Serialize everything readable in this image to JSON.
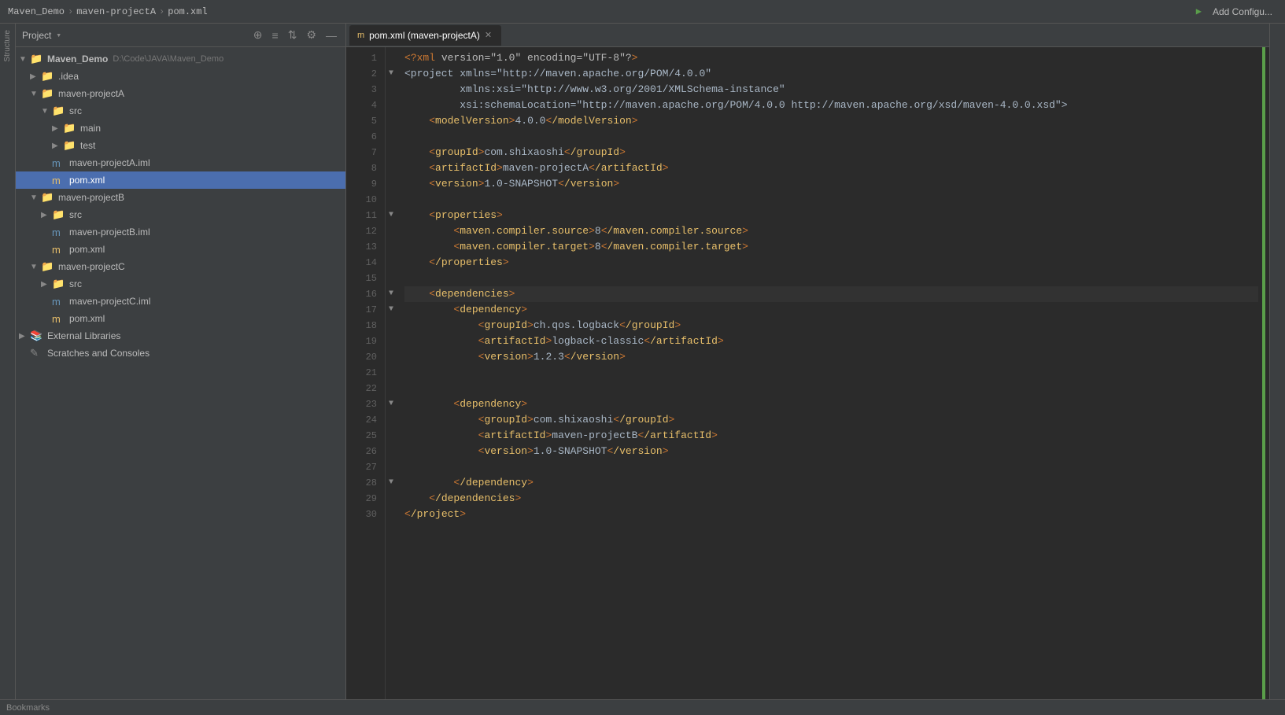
{
  "titleBar": {
    "breadcrumb": [
      "Maven_Demo",
      "maven-projectA",
      "pom.xml"
    ],
    "addConfigLabel": "Add Configu..."
  },
  "projectPanel": {
    "title": "Project",
    "dropdownArrow": "▾",
    "icons": [
      "⊕",
      "≡",
      "⇅",
      "⚙",
      "—"
    ]
  },
  "tree": {
    "items": [
      {
        "id": "project-root",
        "label": "Project ▾",
        "depth": 0,
        "arrow": "",
        "icon": "📁",
        "iconClass": ""
      },
      {
        "id": "maven-demo",
        "label": "Maven_Demo",
        "depth": 0,
        "arrow": "",
        "icon": "📁",
        "iconClass": "folder-icon",
        "extra": "D:\\Code\\JAVA\\Maven_Demo"
      },
      {
        "id": "idea",
        "label": ".idea",
        "depth": 1,
        "arrow": "▶",
        "icon": "📁",
        "iconClass": "folder-icon"
      },
      {
        "id": "maven-projectA",
        "label": "maven-projectA",
        "depth": 1,
        "arrow": "▼",
        "icon": "📁",
        "iconClass": "folder-icon"
      },
      {
        "id": "src-a",
        "label": "src",
        "depth": 2,
        "arrow": "▼",
        "icon": "📁",
        "iconClass": "folder-icon"
      },
      {
        "id": "main",
        "label": "main",
        "depth": 3,
        "arrow": "▶",
        "icon": "📁",
        "iconClass": "folder-icon"
      },
      {
        "id": "test",
        "label": "test",
        "depth": 3,
        "arrow": "▶",
        "icon": "📁",
        "iconClass": "folder-icon"
      },
      {
        "id": "iml-a",
        "label": "maven-projectA.iml",
        "depth": 2,
        "arrow": "",
        "icon": "m",
        "iconClass": "file-icon-iml"
      },
      {
        "id": "pom-a",
        "label": "pom.xml",
        "depth": 2,
        "arrow": "",
        "icon": "m",
        "iconClass": "file-icon-xml",
        "selected": true
      },
      {
        "id": "maven-projectB",
        "label": "maven-projectB",
        "depth": 1,
        "arrow": "▼",
        "icon": "📁",
        "iconClass": "folder-icon"
      },
      {
        "id": "src-b",
        "label": "src",
        "depth": 2,
        "arrow": "▶",
        "icon": "📁",
        "iconClass": "folder-icon"
      },
      {
        "id": "iml-b",
        "label": "maven-projectB.iml",
        "depth": 2,
        "arrow": "",
        "icon": "m",
        "iconClass": "file-icon-iml"
      },
      {
        "id": "pom-b",
        "label": "pom.xml",
        "depth": 2,
        "arrow": "",
        "icon": "m",
        "iconClass": "file-icon-xml"
      },
      {
        "id": "maven-projectC",
        "label": "maven-projectC",
        "depth": 1,
        "arrow": "▼",
        "icon": "📁",
        "iconClass": "folder-icon"
      },
      {
        "id": "src-c",
        "label": "src",
        "depth": 2,
        "arrow": "▶",
        "icon": "📁",
        "iconClass": "folder-icon"
      },
      {
        "id": "iml-c",
        "label": "maven-projectC.iml",
        "depth": 2,
        "arrow": "",
        "icon": "m",
        "iconClass": "file-icon-iml"
      },
      {
        "id": "pom-c",
        "label": "pom.xml",
        "depth": 2,
        "arrow": "",
        "icon": "m",
        "iconClass": "file-icon-xml"
      },
      {
        "id": "external-libs",
        "label": "External Libraries",
        "depth": 0,
        "arrow": "▶",
        "icon": "📚",
        "iconClass": "external-icon"
      },
      {
        "id": "scratches",
        "label": "Scratches and Consoles",
        "depth": 0,
        "arrow": "",
        "icon": "✎",
        "iconClass": "scratches-icon"
      }
    ]
  },
  "tabs": [
    {
      "id": "pom-xml-tab",
      "label": "pom.xml (maven-projectA)",
      "active": true,
      "modified": false
    }
  ],
  "editor": {
    "filename": "pom.xml",
    "lines": [
      {
        "num": 1,
        "fold": "",
        "code": "<?xml version=\"1.0\" encoding=\"UTF-8\"?>",
        "highlight": false
      },
      {
        "num": 2,
        "fold": "▼",
        "code": "<project xmlns=\"http://maven.apache.org/POM/4.0.0\"",
        "highlight": false
      },
      {
        "num": 3,
        "fold": "",
        "code": "         xmlns:xsi=\"http://www.w3.org/2001/XMLSchema-instance\"",
        "highlight": false
      },
      {
        "num": 4,
        "fold": "",
        "code": "         xsi:schemaLocation=\"http://maven.apache.org/POM/4.0.0 http://maven.apache.org/xsd/maven-4.0.0.xsd\">",
        "highlight": false
      },
      {
        "num": 5,
        "fold": "",
        "code": "    <modelVersion>4.0.0</modelVersion>",
        "highlight": false
      },
      {
        "num": 6,
        "fold": "",
        "code": "",
        "highlight": false
      },
      {
        "num": 7,
        "fold": "",
        "code": "    <groupId>com.shixaoshi</groupId>",
        "highlight": false
      },
      {
        "num": 8,
        "fold": "",
        "code": "    <artifactId>maven-projectA</artifactId>",
        "highlight": false
      },
      {
        "num": 9,
        "fold": "",
        "code": "    <version>1.0-SNAPSHOT</version>",
        "highlight": false
      },
      {
        "num": 10,
        "fold": "",
        "code": "",
        "highlight": false
      },
      {
        "num": 11,
        "fold": "▼",
        "code": "    <properties>",
        "highlight": false
      },
      {
        "num": 12,
        "fold": "",
        "code": "        <maven.compiler.source>8</maven.compiler.source>",
        "highlight": false
      },
      {
        "num": 13,
        "fold": "",
        "code": "        <maven.compiler.target>8</maven.compiler.target>",
        "highlight": false
      },
      {
        "num": 14,
        "fold": "",
        "code": "    </properties>",
        "highlight": false
      },
      {
        "num": 15,
        "fold": "",
        "code": "",
        "highlight": false
      },
      {
        "num": 16,
        "fold": "▼",
        "code": "    <dependencies>",
        "highlight": true
      },
      {
        "num": 17,
        "fold": "▼",
        "code": "        <dependency>",
        "highlight": false
      },
      {
        "num": 18,
        "fold": "",
        "code": "            <groupId>ch.qos.logback</groupId>",
        "highlight": false
      },
      {
        "num": 19,
        "fold": "",
        "code": "            <artifactId>logback-classic</artifactId>",
        "highlight": false
      },
      {
        "num": 20,
        "fold": "",
        "code": "            <version>1.2.3</version>",
        "highlight": false
      },
      {
        "num": 21,
        "fold": "",
        "code": "",
        "highlight": false
      },
      {
        "num": 22,
        "fold": "",
        "code": "",
        "highlight": false
      },
      {
        "num": 23,
        "fold": "▼",
        "code": "        <dependency>",
        "highlight": false
      },
      {
        "num": 24,
        "fold": "",
        "code": "            <groupId>com.shixaoshi</groupId>",
        "highlight": false
      },
      {
        "num": 25,
        "fold": "",
        "code": "            <artifactId>maven-projectB</artifactId>",
        "highlight": false
      },
      {
        "num": 26,
        "fold": "",
        "code": "            <version>1.0-SNAPSHOT</version>",
        "highlight": false
      },
      {
        "num": 27,
        "fold": "",
        "code": "",
        "highlight": false
      },
      {
        "num": 28,
        "fold": "▼",
        "code": "        </dependency>",
        "highlight": false
      },
      {
        "num": 29,
        "fold": "",
        "code": "    </dependencies>",
        "highlight": false
      },
      {
        "num": 30,
        "fold": "",
        "code": "</project>",
        "highlight": false
      }
    ]
  },
  "statusBar": {
    "structure": "Structure",
    "bookmarks": "Bookmarks"
  }
}
